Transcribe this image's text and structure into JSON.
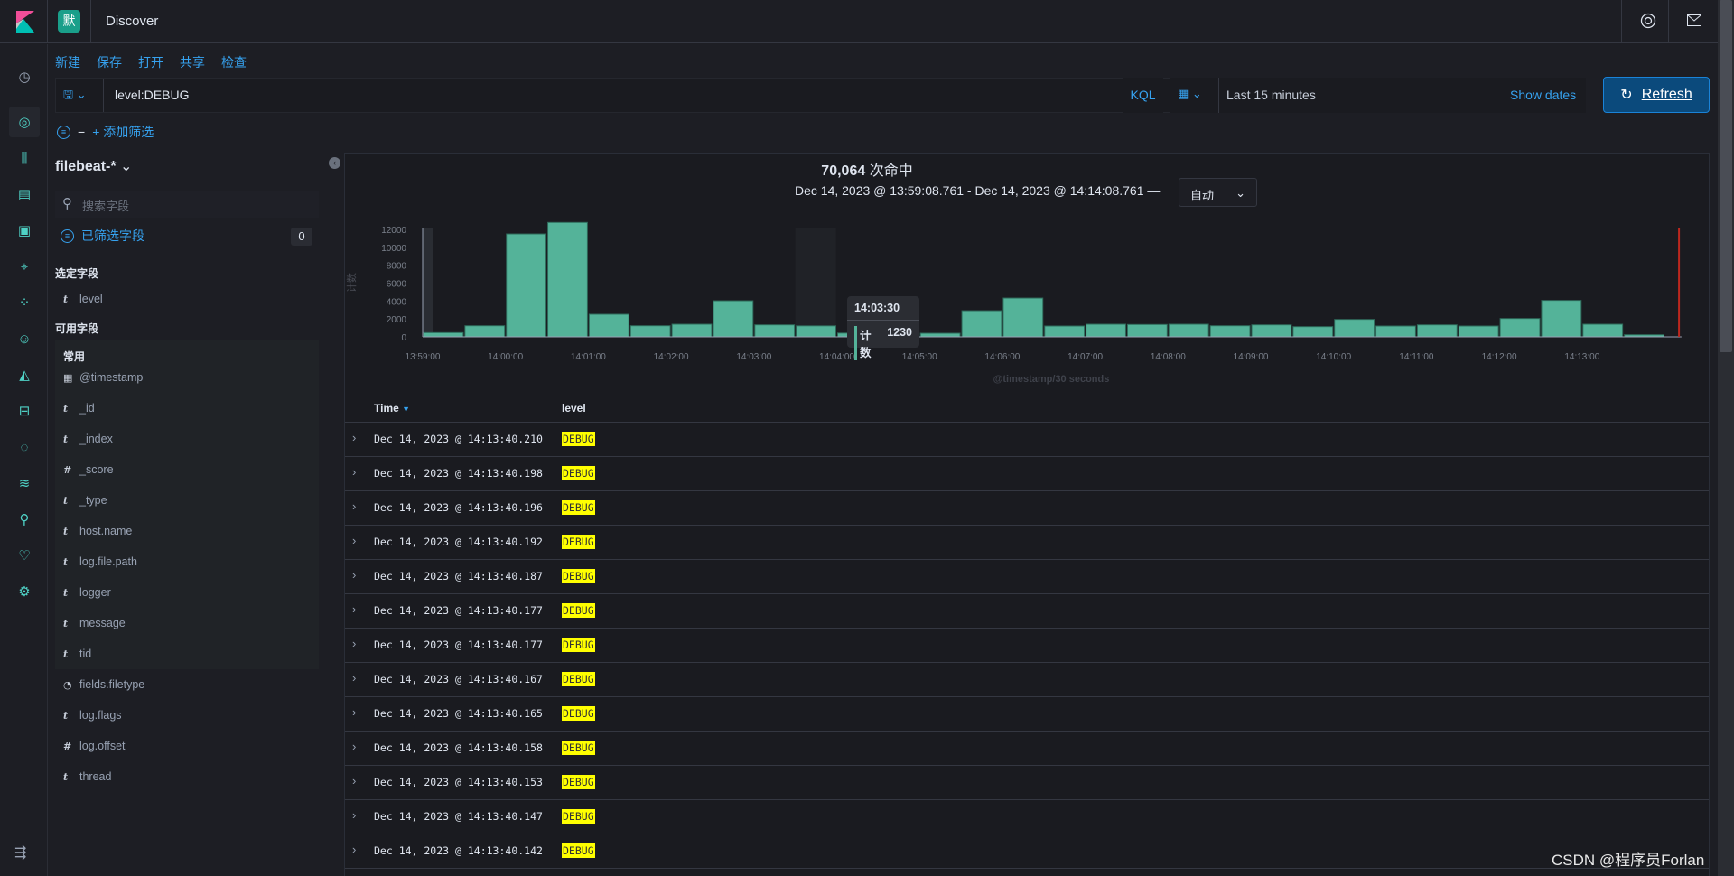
{
  "header": {
    "space_badge": "默",
    "title": "Discover"
  },
  "menu": {
    "items": [
      "新建",
      "保存",
      "打开",
      "共享",
      "检查"
    ]
  },
  "query": {
    "value": "level:DEBUG",
    "language": "KQL"
  },
  "time": {
    "range_label": "Last 15 minutes",
    "show_dates": "Show dates",
    "refresh": "Refresh"
  },
  "filters": {
    "add_filter": "+ 添加筛选",
    "dash": "−"
  },
  "sidebar": {
    "index_pattern": "filebeat-*",
    "search_placeholder": "搜索字段",
    "filtered_fields_label": "已筛选字段",
    "filtered_fields_count": "0",
    "selected_title": "选定字段",
    "selected_fields": [
      {
        "type": "t",
        "name": "level"
      }
    ],
    "available_title": "可用字段",
    "common_title": "常用",
    "common_fields": [
      {
        "type": "date",
        "name": "@timestamp"
      },
      {
        "type": "t",
        "name": "_id"
      },
      {
        "type": "t",
        "name": "_index"
      },
      {
        "type": "#",
        "name": "_score"
      },
      {
        "type": "t",
        "name": "_type"
      },
      {
        "type": "t",
        "name": "host.name"
      },
      {
        "type": "t",
        "name": "log.file.path"
      },
      {
        "type": "t",
        "name": "logger"
      },
      {
        "type": "t",
        "name": "message"
      },
      {
        "type": "t",
        "name": "tid"
      }
    ],
    "other_fields": [
      {
        "type": "?",
        "name": "fields.filetype"
      },
      {
        "type": "t",
        "name": "log.flags"
      },
      {
        "type": "#",
        "name": "log.offset"
      },
      {
        "type": "t",
        "name": "thread"
      }
    ]
  },
  "results": {
    "hits": "70,064",
    "hits_suffix": "次命中",
    "range": "Dec 14, 2023 @ 13:59:08.761 - Dec 14, 2023 @ 14:14:08.761 —",
    "interval": "自动"
  },
  "tooltip": {
    "time": "14:03:30",
    "label": "计数",
    "value": "1230"
  },
  "chart_data": {
    "type": "bar",
    "ylabel": "计数",
    "xlabel": "@timestamp/30 seconds",
    "ylim": [
      0,
      12800
    ],
    "yticks": [
      0,
      2000,
      4000,
      6000,
      8000,
      10000,
      12000
    ],
    "xticks": [
      "13:59:00",
      "14:00:00",
      "14:01:00",
      "14:02:00",
      "14:03:00",
      "14:04:00",
      "14:05:00",
      "14:06:00",
      "14:07:00",
      "14:08:00",
      "14:09:00",
      "14:10:00",
      "14:11:00",
      "14:12:00",
      "14:13:00"
    ],
    "categories": [
      "13:59:00",
      "13:59:30",
      "14:00:00",
      "14:00:30",
      "14:01:00",
      "14:01:30",
      "14:02:00",
      "14:02:30",
      "14:03:00",
      "14:03:30",
      "14:04:00",
      "14:04:30",
      "14:05:00",
      "14:05:30",
      "14:06:00",
      "14:06:30",
      "14:07:00",
      "14:07:30",
      "14:08:00",
      "14:08:30",
      "14:09:00",
      "14:09:30",
      "14:10:00",
      "14:10:30",
      "14:11:00",
      "14:11:30",
      "14:12:00",
      "14:12:30",
      "14:13:00",
      "14:13:30"
    ],
    "values": [
      470,
      1240,
      11490,
      12770,
      2520,
      1240,
      1410,
      4030,
      1340,
      1230,
      420,
      450,
      400,
      2920,
      4330,
      1210,
      1410,
      1380,
      1410,
      1240,
      1340,
      1140,
      1950,
      1210,
      1340,
      1210,
      2050,
      4070,
      1410,
      235
    ],
    "color": "#54b399",
    "grid": false
  },
  "table": {
    "columns": [
      "Time",
      "level"
    ],
    "rows": [
      {
        "time": "Dec 14, 2023 @ 14:13:40.210",
        "level": "DEBUG"
      },
      {
        "time": "Dec 14, 2023 @ 14:13:40.198",
        "level": "DEBUG"
      },
      {
        "time": "Dec 14, 2023 @ 14:13:40.196",
        "level": "DEBUG"
      },
      {
        "time": "Dec 14, 2023 @ 14:13:40.192",
        "level": "DEBUG"
      },
      {
        "time": "Dec 14, 2023 @ 14:13:40.187",
        "level": "DEBUG"
      },
      {
        "time": "Dec 14, 2023 @ 14:13:40.177",
        "level": "DEBUG"
      },
      {
        "time": "Dec 14, 2023 @ 14:13:40.177",
        "level": "DEBUG"
      },
      {
        "time": "Dec 14, 2023 @ 14:13:40.167",
        "level": "DEBUG"
      },
      {
        "time": "Dec 14, 2023 @ 14:13:40.165",
        "level": "DEBUG"
      },
      {
        "time": "Dec 14, 2023 @ 14:13:40.158",
        "level": "DEBUG"
      },
      {
        "time": "Dec 14, 2023 @ 14:13:40.153",
        "level": "DEBUG"
      },
      {
        "time": "Dec 14, 2023 @ 14:13:40.147",
        "level": "DEBUG"
      },
      {
        "time": "Dec 14, 2023 @ 14:13:40.142",
        "level": "DEBUG"
      }
    ]
  },
  "nav_icons": [
    "clock-icon",
    "discover-icon",
    "visualize-icon",
    "dashboard-icon",
    "canvas-icon",
    "maps-icon",
    "ml-icon",
    "users-icon",
    "graph-icon",
    "logs-icon",
    "uptime-icon",
    "apm-icon",
    "dev-tools-icon",
    "monitoring-icon",
    "management-icon"
  ],
  "watermark": "CSDN @程序员Forlan",
  "colors": {
    "accent": "#36a2ef",
    "bar": "#54b399",
    "highlight": "#ffff00",
    "refresh": "#0b4a7c"
  }
}
